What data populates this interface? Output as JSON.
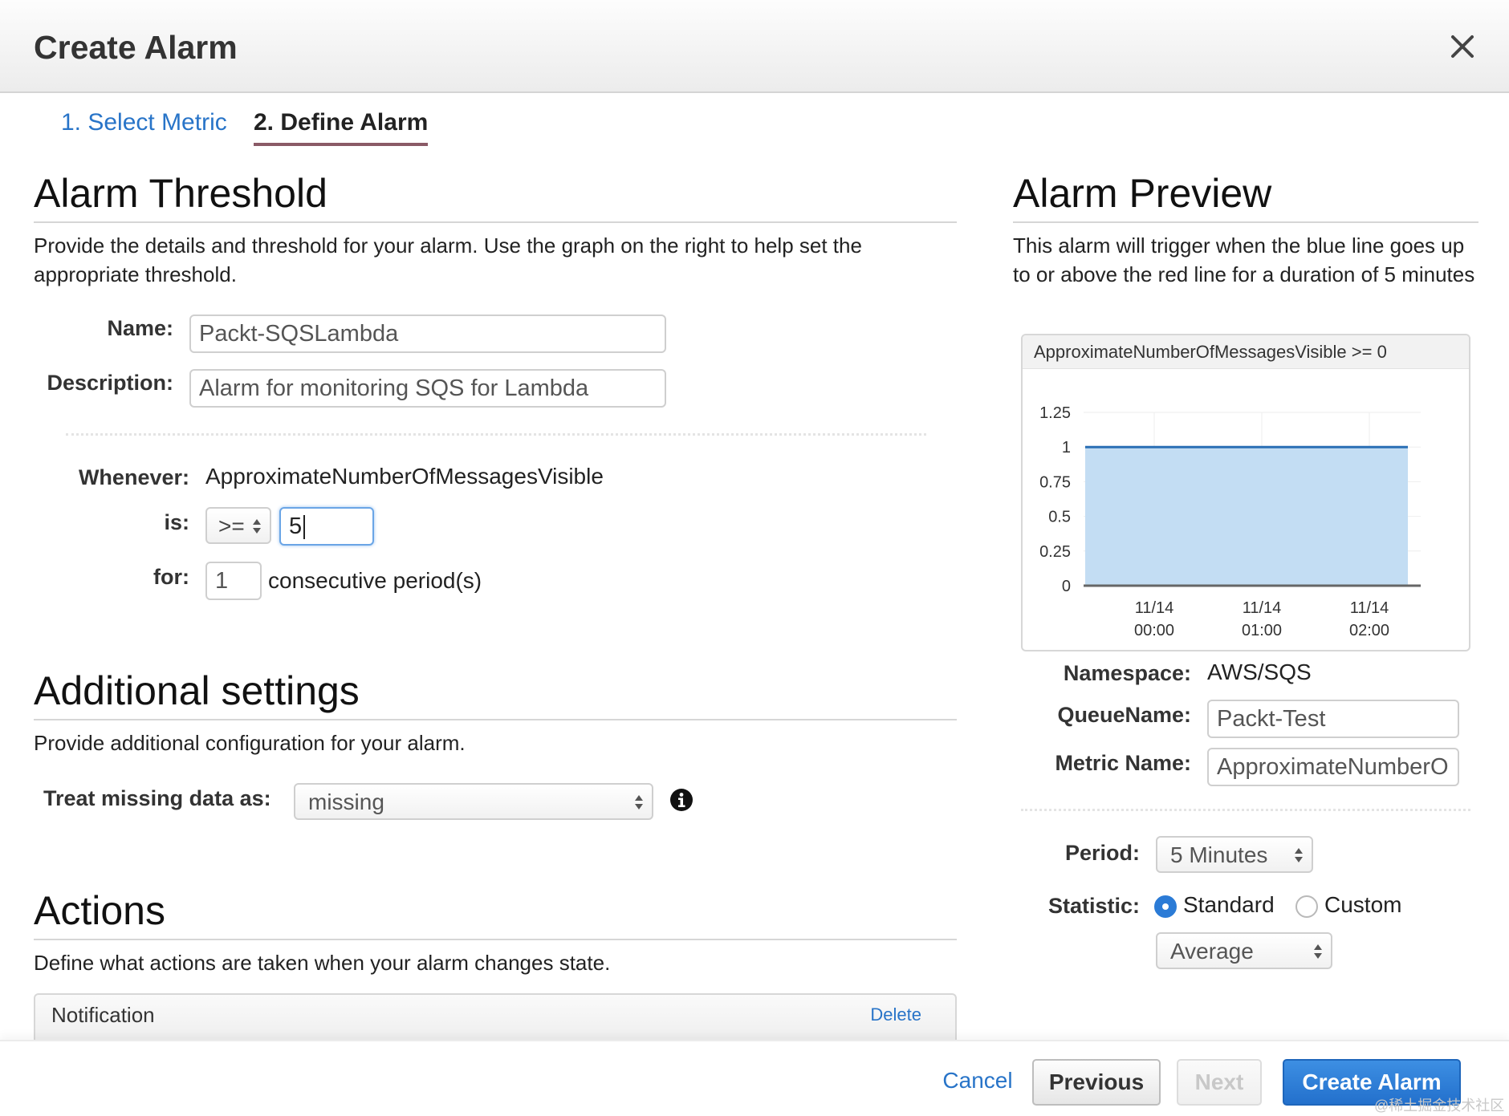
{
  "dialog": {
    "title": "Create Alarm"
  },
  "steps": {
    "step1": "1. Select Metric",
    "step2": "2. Define Alarm"
  },
  "threshold": {
    "heading": "Alarm Threshold",
    "description": "Provide the details and threshold for your alarm. Use the graph on the right to help set the appropriate threshold.",
    "name_label": "Name:",
    "name_value": "Packt-SQSLambda",
    "desc_label": "Description:",
    "desc_value": "Alarm for monitoring SQS for Lambda",
    "whenever_label": "Whenever:",
    "whenever_value": "ApproximateNumberOfMessagesVisible",
    "is_label": "is:",
    "operator": ">=",
    "threshold_value": "5",
    "for_label": "for:",
    "periods_value": "1",
    "periods_suffix": "consecutive period(s)"
  },
  "additional": {
    "heading": "Additional settings",
    "description": "Provide additional configuration for your alarm.",
    "missing_label": "Treat missing data as:",
    "missing_value": "missing"
  },
  "actions": {
    "heading": "Actions",
    "description": "Define what actions are taken when your alarm changes state.",
    "notification_label": "Notification",
    "delete_label": "Delete"
  },
  "preview": {
    "heading": "Alarm Preview",
    "description": "This alarm will trigger when the blue line goes up to or above the red line for a duration of 5 minutes",
    "chart_title": "ApproximateNumberOfMessagesVisible >= 0",
    "namespace_label": "Namespace:",
    "namespace_value": "AWS/SQS",
    "queue_label": "QueueName:",
    "queue_value": "Packt-Test",
    "metric_label": "Metric Name:",
    "metric_value": "ApproximateNumberO",
    "period_label": "Period:",
    "period_value": "5 Minutes",
    "statistic_label": "Statistic:",
    "statistic_standard": "Standard",
    "statistic_custom": "Custom",
    "statistic_value": "Average"
  },
  "footer": {
    "cancel": "Cancel",
    "previous": "Previous",
    "next": "Next",
    "create": "Create Alarm"
  },
  "watermark": "@稀土掘金技术社区",
  "colors": {
    "link": "#2874c8",
    "primary": "#2b7bd6",
    "area_fill": "#c3ddf3",
    "area_line": "#2a6fb5"
  },
  "chart_data": {
    "type": "area",
    "title": "ApproximateNumberOfMessagesVisible >= 0",
    "x_ticks": [
      {
        "day": "11/14",
        "time": "00:00"
      },
      {
        "day": "11/14",
        "time": "01:00"
      },
      {
        "day": "11/14",
        "time": "02:00"
      }
    ],
    "y_ticks": [
      "1.25",
      "1",
      "0.75",
      "0.5",
      "0.25",
      "0"
    ],
    "ylim": [
      0,
      1.25
    ],
    "series": [
      {
        "values": [
          1,
          1,
          1,
          1
        ]
      }
    ],
    "grid": true
  }
}
